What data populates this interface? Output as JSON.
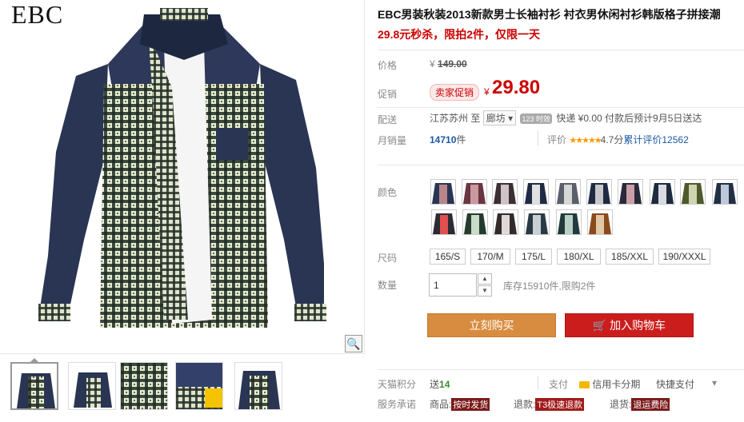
{
  "brand": "EBC",
  "product": {
    "title": "EBC男装秋装2013新款男士长袖衬衫 衬衣男休闲衬衫韩版格子拼接潮",
    "subtitle": "29.8元秒杀，限拍2件，仅限一天"
  },
  "price": {
    "label": "价格",
    "currency": "¥",
    "original": "149.00",
    "promo_label": "促销",
    "promo_tag": "卖家促销",
    "current": "29.80"
  },
  "shipping": {
    "label": "配送",
    "from": "江苏苏州",
    "to_word": "至",
    "to_city": "廊坊",
    "badge": "123 时效",
    "method": "快递 ¥0.00 付款后预计9月5日送达"
  },
  "sales": {
    "label": "月销量",
    "count": "14710",
    "unit": "件",
    "rating_label": "评价",
    "stars": "★★★★★",
    "score": "4.7分",
    "cumulative": "累计评价",
    "review_count": "12562"
  },
  "color": {
    "label": "颜色"
  },
  "size": {
    "label": "尺码",
    "options": [
      "165/S",
      "170/M",
      "175/L",
      "180/XL",
      "185/XXL",
      "190/XXXL"
    ]
  },
  "quantity": {
    "label": "数量",
    "value": "1",
    "up": "▲",
    "down": "▼",
    "stock": "库存15910件,限购2件"
  },
  "buttons": {
    "buy_now": "立刻购买",
    "add_cart": "加入购物车",
    "cart_icon": "🛒"
  },
  "payment": {
    "points_label": "天猫积分",
    "points_prefix": "送",
    "points_value": "14",
    "pay_label": "支付",
    "credit": "信用卡分期",
    "quick": "快捷支付",
    "chevron": "▾"
  },
  "promise": {
    "label": "服务承诺",
    "goods": "商品:",
    "goods_tag": "按时发货",
    "refund": "退款:",
    "refund_tag": "T3极速退款",
    "return": "退货:",
    "return_tag": "退运费险"
  },
  "zoom_icon": "🔍",
  "colors_accent": {
    "price": "#cc0000",
    "buy": "#d88c3f",
    "cart": "#cc1d1d",
    "link": "#1a5aa5"
  },
  "icons": [
    "magnifier-icon",
    "cart-icon",
    "stepper-up-icon",
    "stepper-down-icon",
    "credit-card-icon",
    "chevron-down-icon"
  ]
}
